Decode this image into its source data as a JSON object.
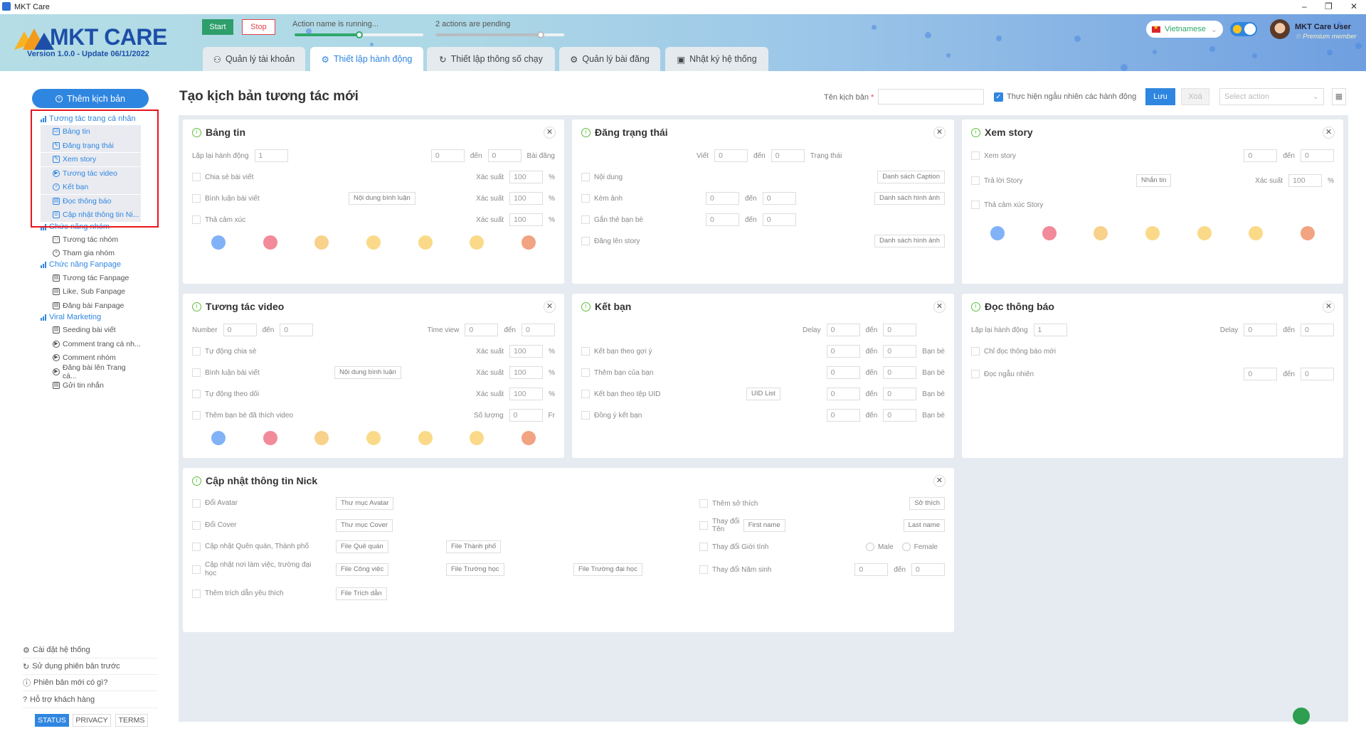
{
  "window": {
    "title": "MKT Care",
    "controls": [
      "–",
      "❐",
      "✕"
    ]
  },
  "header": {
    "logo_text": "MKT CARE",
    "version": "Version 1.0.0 - Update 06/11/2022",
    "start": "Start",
    "stop": "Stop",
    "progress": [
      {
        "label": "Action name is running...",
        "value": 0.5,
        "color": "#2ea86a"
      },
      {
        "label": "2 actions are pending",
        "value": 0.82,
        "color": "#b8bcc0"
      }
    ],
    "tabs": [
      {
        "label": "Quản lý tài khoản",
        "icon": "sitemap-icon"
      },
      {
        "label": "Thiết lập hành động",
        "icon": "gear-icon",
        "active": true
      },
      {
        "label": "Thiết lập thông số chạy",
        "icon": "refresh-icon"
      },
      {
        "label": "Quản lý bài đăng",
        "icon": "gear-icon"
      },
      {
        "label": "Nhật ký hệ thống",
        "icon": "terminal-icon"
      }
    ],
    "language": "Vietnamese",
    "user_name": "MKT Care User",
    "user_role": "☆ Premium member"
  },
  "sidebar": {
    "add_button": "Thêm kịch bản",
    "groups": [
      {
        "title": "Tương tác trang cá nhân",
        "items": [
          "Bảng tin",
          "Đăng trạng thái",
          "Xem story",
          "Tương tác video",
          "Kết bạn",
          "Đọc thông báo",
          "Cập nhật thông tin Ni..."
        ],
        "selected": true
      },
      {
        "title": "Chức năng nhóm",
        "items": [
          "Tương tác nhóm",
          "Tham gia nhóm"
        ]
      },
      {
        "title": "Chức năng Fanpage",
        "items": [
          "Tương tác Fanpage",
          "Like, Sub Fanpage",
          "Đăng bài Fanpage"
        ]
      },
      {
        "title": "Viral Marketing",
        "items": [
          "Seeding bài viết",
          "Comment trang cá nh...",
          "Comment nhóm",
          "Đăng bài lên Trang cá...",
          "Gửi tin nhắn"
        ]
      }
    ],
    "bottom_links": [
      {
        "label": "Cài đặt hệ thống",
        "icon": "gear-icon"
      },
      {
        "label": "Sử dụng phiên bản trước",
        "icon": "refresh-icon"
      },
      {
        "label": "Phiên bản mới có gì?",
        "icon": "info-icon"
      },
      {
        "label": "Hỗ trợ khách hàng",
        "icon": "help-icon"
      }
    ],
    "footer_buttons": [
      "STATUS",
      "PRIVACY",
      "TERMS"
    ]
  },
  "toolbar": {
    "page_title": "Tạo kịch bản tương tác mới",
    "name_label": "Tên kịch bản",
    "required": "*",
    "name_value": "",
    "random_label": "Thực hiện ngẫu nhiên các hành động",
    "random_checked": true,
    "save": "Lưu",
    "delete": "Xoá",
    "select_placeholder": "Select action"
  },
  "colors": {
    "accent": "#2f86e0",
    "start": "#2e9e6a",
    "stop": "#e0424a",
    "info": "#5cbf3a",
    "highlight_box": "#e8141b"
  },
  "cards": [
    {
      "id": "bang-tin",
      "title": "Bảng tin",
      "rows": [
        {
          "left": [
            {
              "t": "lbl",
              "v": "Lặp lại hành động"
            },
            {
              "t": "inp",
              "v": "1"
            }
          ],
          "right": [
            {
              "t": "inp",
              "v": "0"
            },
            {
              "t": "lbl",
              "v": "đến"
            },
            {
              "t": "inp",
              "v": "0"
            },
            {
              "t": "lbl",
              "v": "Bài đăng"
            }
          ]
        },
        {
          "check": "Chia sẻ bài viết",
          "right": [
            {
              "t": "lbl",
              "v": "Xác suất"
            },
            {
              "t": "inp",
              "v": "100"
            },
            {
              "t": "lbl",
              "v": "%"
            }
          ]
        },
        {
          "check": "Bình luận bài viết",
          "mid": [
            {
              "t": "btn",
              "v": "Nội dung bình luận"
            }
          ],
          "right": [
            {
              "t": "lbl",
              "v": "Xác suất"
            },
            {
              "t": "inp",
              "v": "100"
            },
            {
              "t": "lbl",
              "v": "%"
            }
          ]
        },
        {
          "check": "Thả cảm xúc",
          "right": [
            {
              "t": "lbl",
              "v": "Xác suất"
            },
            {
              "t": "inp",
              "v": "100"
            },
            {
              "t": "lbl",
              "v": "%"
            }
          ]
        }
      ],
      "reactions": [
        "like",
        "love",
        "care",
        "haha",
        "wow",
        "sad",
        "angry"
      ]
    },
    {
      "id": "dang-trang-thai",
      "title": "Đăng trạng thái",
      "rows": [
        {
          "mid": [
            {
              "t": "lbl",
              "v": "Viết"
            },
            {
              "t": "inp",
              "v": "0"
            },
            {
              "t": "lbl",
              "v": "đến"
            },
            {
              "t": "inp",
              "v": "0"
            },
            {
              "t": "lbl",
              "v": "Trạng thái"
            }
          ],
          "midpos": "viet"
        },
        {
          "check": "Nội dung",
          "right": [
            {
              "t": "btn",
              "v": "Danh sách Caption"
            }
          ]
        },
        {
          "check": "Kèm ảnh",
          "mid": [
            {
              "t": "inp",
              "v": "0"
            },
            {
              "t": "lbl",
              "v": "đến"
            },
            {
              "t": "inp",
              "v": "0"
            }
          ],
          "right": [
            {
              "t": "btn",
              "v": "Danh sách hình ảnh"
            }
          ]
        },
        {
          "check": "Gắn thẻ bạn bè",
          "mid": [
            {
              "t": "inp",
              "v": "0"
            },
            {
              "t": "lbl",
              "v": "đến"
            },
            {
              "t": "inp",
              "v": "0"
            }
          ]
        },
        {
          "check": "Đăng lên story",
          "right": [
            {
              "t": "btn",
              "v": "Danh sách hình ảnh"
            }
          ]
        }
      ]
    },
    {
      "id": "xem-story",
      "title": "Xem story",
      "rows": [
        {
          "check": "Xem story",
          "right": [
            {
              "t": "inp",
              "v": "0"
            },
            {
              "t": "lbl",
              "v": "đến"
            },
            {
              "t": "inp",
              "v": "0"
            }
          ]
        },
        {
          "check": "Trả lời Story",
          "mid": [
            {
              "t": "btn",
              "v": "Nhắn tin"
            }
          ],
          "right": [
            {
              "t": "lbl",
              "v": "Xác suất"
            },
            {
              "t": "inp",
              "v": "100"
            },
            {
              "t": "lbl",
              "v": "%"
            }
          ]
        },
        {
          "check": "Thả cảm xúc Story"
        }
      ],
      "reactions": [
        "like",
        "love",
        "care",
        "haha",
        "wow",
        "sad",
        "angry"
      ]
    },
    {
      "id": "tuong-tac-video",
      "title": "Tương tác video",
      "rows": [
        {
          "left": [
            {
              "t": "lbl",
              "v": "Number"
            },
            {
              "t": "inp",
              "v": "0"
            },
            {
              "t": "lbl",
              "v": "đến"
            },
            {
              "t": "inp",
              "v": "0"
            }
          ],
          "right": [
            {
              "t": "lbl",
              "v": "Time view"
            },
            {
              "t": "inp",
              "v": "0"
            },
            {
              "t": "lbl",
              "v": "đến"
            },
            {
              "t": "inp",
              "v": "0"
            }
          ]
        },
        {
          "check": "Tự động chia sẻ",
          "right": [
            {
              "t": "lbl",
              "v": "Xác suất"
            },
            {
              "t": "inp",
              "v": "100"
            },
            {
              "t": "lbl",
              "v": "%"
            }
          ]
        },
        {
          "check": "Bình luận bài viết",
          "mid": [
            {
              "t": "btn",
              "v": "Nội dung bình luận"
            }
          ],
          "right": [
            {
              "t": "lbl",
              "v": "Xác suất"
            },
            {
              "t": "inp",
              "v": "100"
            },
            {
              "t": "lbl",
              "v": "%"
            }
          ]
        },
        {
          "check": "Tự động theo dõi",
          "right": [
            {
              "t": "lbl",
              "v": "Xác suất"
            },
            {
              "t": "inp",
              "v": "100"
            },
            {
              "t": "lbl",
              "v": "%"
            }
          ]
        },
        {
          "check": "Thêm bạn bè đã thích video",
          "right": [
            {
              "t": "lbl",
              "v": "Số lượng"
            },
            {
              "t": "inp",
              "v": "0"
            },
            {
              "t": "lbl",
              "v": "Fr"
            }
          ]
        }
      ],
      "reactions": [
        "like",
        "love",
        "care",
        "haha",
        "wow",
        "sad",
        "angry"
      ]
    },
    {
      "id": "ket-ban",
      "title": "Kết bạn",
      "rows": [
        {
          "right": [
            {
              "t": "lbl",
              "v": "Delay"
            },
            {
              "t": "inp",
              "v": "0"
            },
            {
              "t": "lbl",
              "v": "đến"
            },
            {
              "t": "inp",
              "v": "0"
            },
            {
              "t": "lbl",
              "v": "Bạn bè",
              "hidden": true
            }
          ]
        },
        {
          "check": "Kết bạn theo gợi ý",
          "right": [
            {
              "t": "inp",
              "v": "0"
            },
            {
              "t": "lbl",
              "v": "đến"
            },
            {
              "t": "inp",
              "v": "0"
            },
            {
              "t": "lbl",
              "v": "Bạn bè"
            }
          ]
        },
        {
          "check": "Thêm bạn của bạn",
          "right": [
            {
              "t": "inp",
              "v": "0"
            },
            {
              "t": "lbl",
              "v": "đến"
            },
            {
              "t": "inp",
              "v": "0"
            },
            {
              "t": "lbl",
              "v": "Bạn bè"
            }
          ]
        },
        {
          "check": "Kết bạn theo tệp UID",
          "mid": [
            {
              "t": "btn",
              "v": "UID List"
            }
          ],
          "right": [
            {
              "t": "inp",
              "v": "0"
            },
            {
              "t": "lbl",
              "v": "đến"
            },
            {
              "t": "inp",
              "v": "0"
            },
            {
              "t": "lbl",
              "v": "Bạn bè"
            }
          ]
        },
        {
          "check": "Đồng ý kết bạn",
          "right": [
            {
              "t": "inp",
              "v": "0"
            },
            {
              "t": "lbl",
              "v": "đến"
            },
            {
              "t": "inp",
              "v": "0"
            },
            {
              "t": "lbl",
              "v": "Bạn bè"
            }
          ]
        }
      ]
    },
    {
      "id": "doc-thong-bao",
      "title": "Đọc thông báo",
      "rows": [
        {
          "left": [
            {
              "t": "lbl",
              "v": "Lặp lại hành động"
            },
            {
              "t": "inp",
              "v": "1"
            }
          ],
          "right": [
            {
              "t": "lbl",
              "v": "Delay"
            },
            {
              "t": "inp",
              "v": "0"
            },
            {
              "t": "lbl",
              "v": "đến"
            },
            {
              "t": "inp",
              "v": "0"
            }
          ]
        },
        {
          "check": "Chỉ đọc thông báo mới"
        },
        {
          "check": "Đọc ngẫu nhiên",
          "right": [
            {
              "t": "inp",
              "v": "0"
            },
            {
              "t": "lbl",
              "v": "đến"
            },
            {
              "t": "inp",
              "v": "0"
            }
          ]
        }
      ]
    },
    {
      "id": "cap-nhat-nick",
      "title": "Cập nhật thông tin Nick",
      "left_rows": [
        {
          "check": "Đổi Avatar",
          "btns": [
            "Thư mục Avatar"
          ]
        },
        {
          "check": "Đổi Cover",
          "btns": [
            "Thư mục Cover"
          ]
        },
        {
          "check": "Cập nhật Quên quán, Thành phố",
          "btns": [
            "File Quê quán",
            "File Thành phố"
          ]
        },
        {
          "check": "Cập nhật nơi làm việc, trường đại học",
          "btns": [
            "File Công việc",
            "File Trường học",
            "File Trường đại học"
          ]
        },
        {
          "check": "Thêm trích dẫn yêu thích",
          "btns": [
            "File Trích dẫn"
          ]
        }
      ],
      "right_rows": [
        {
          "check": "Thêm sở thích",
          "right": [
            {
              "t": "btn",
              "v": "Sở thích"
            }
          ]
        },
        {
          "check": "Thay đổi Tên",
          "right": [
            {
              "t": "btn",
              "v": "First name"
            },
            {
              "t": "gap"
            },
            {
              "t": "btn",
              "v": "Last name"
            }
          ]
        },
        {
          "check": "Thay đổi Giới tính",
          "right": [
            {
              "t": "radio",
              "v": "Male"
            },
            {
              "t": "radio",
              "v": "Female"
            }
          ]
        },
        {
          "check": "Thay đổi Năm sinh",
          "right": [
            {
              "t": "inp",
              "v": "0"
            },
            {
              "t": "lbl",
              "v": "đến"
            },
            {
              "t": "inp",
              "v": "0"
            }
          ]
        }
      ]
    }
  ]
}
